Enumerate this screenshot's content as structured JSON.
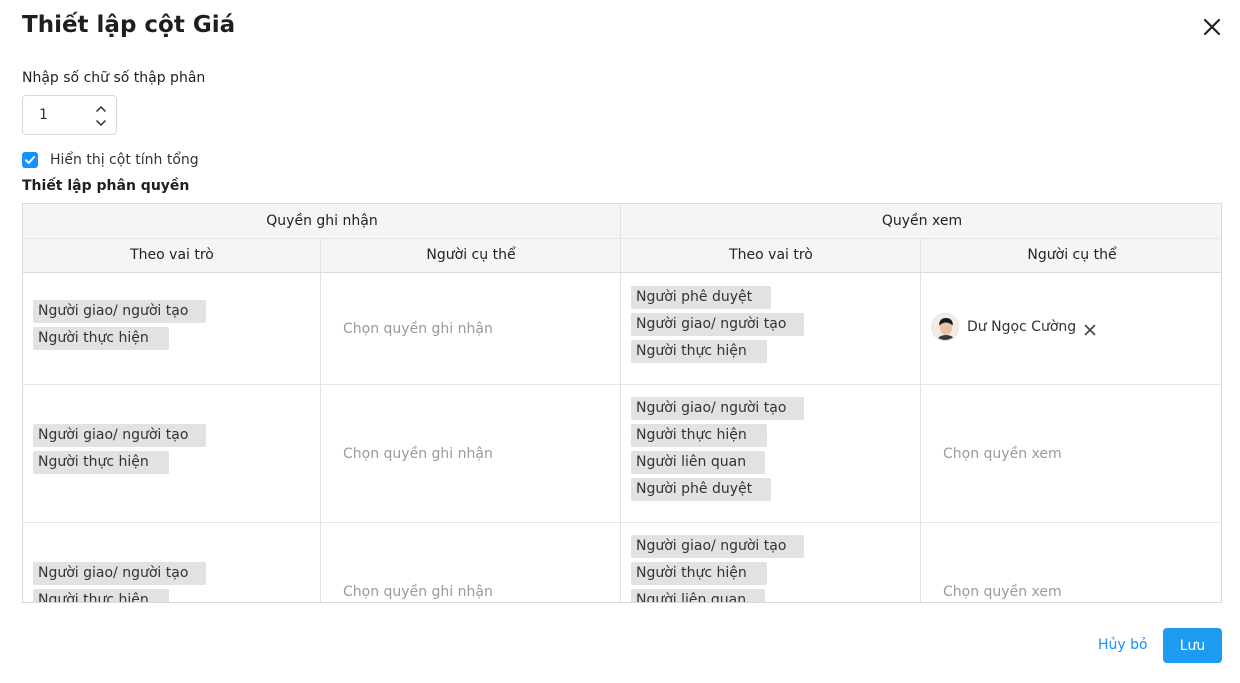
{
  "dialog": {
    "title": "Thiết lập cột Giá"
  },
  "decimal": {
    "label": "Nhập số chữ số thập phân",
    "value": "1"
  },
  "show_total": {
    "label": "Hiển thị cột tính tổng",
    "checked": true
  },
  "permissions": {
    "label": "Thiết lập phân quyền",
    "group_headers": [
      "Quyền ghi nhận",
      "Quyền xem"
    ],
    "sub_headers": [
      "Theo vai trò",
      "Người cụ thể",
      "Theo vai trò",
      "Người cụ thể"
    ],
    "record_placeholder": "Chọn quyền ghi nhận",
    "view_placeholder": "Chọn quyền xem",
    "rows": [
      {
        "record_roles": [
          "Người giao/ người tạo",
          "Người thực hiện"
        ],
        "view_roles": [
          "Người phê duyệt",
          "Người giao/ người tạo",
          "Người thực hiện"
        ],
        "view_users": [
          "Dư Ngọc Cường"
        ]
      },
      {
        "record_roles": [
          "Người giao/ người tạo",
          "Người thực hiện"
        ],
        "view_roles": [
          "Người giao/ người tạo",
          "Người thực hiện",
          "Người liên quan",
          "Người phê duyệt"
        ],
        "view_users": []
      },
      {
        "record_roles": [
          "Người giao/ người tạo",
          "Người thực hiện"
        ],
        "view_roles": [
          "Người giao/ người tạo",
          "Người thực hiện",
          "Người liên quan"
        ],
        "view_users": []
      }
    ]
  },
  "footer": {
    "cancel_label": "Hủy bỏ",
    "save_label": "Lưu"
  },
  "colors": {
    "primary": "#1890ff",
    "save_button": "#1d9bf0",
    "tag_bg": "#e2e2e2",
    "header_bg": "#f5f5f5"
  },
  "icons": [
    "close-icon",
    "chevron-up-icon",
    "chevron-down-icon",
    "check-icon",
    "remove-icon"
  ]
}
